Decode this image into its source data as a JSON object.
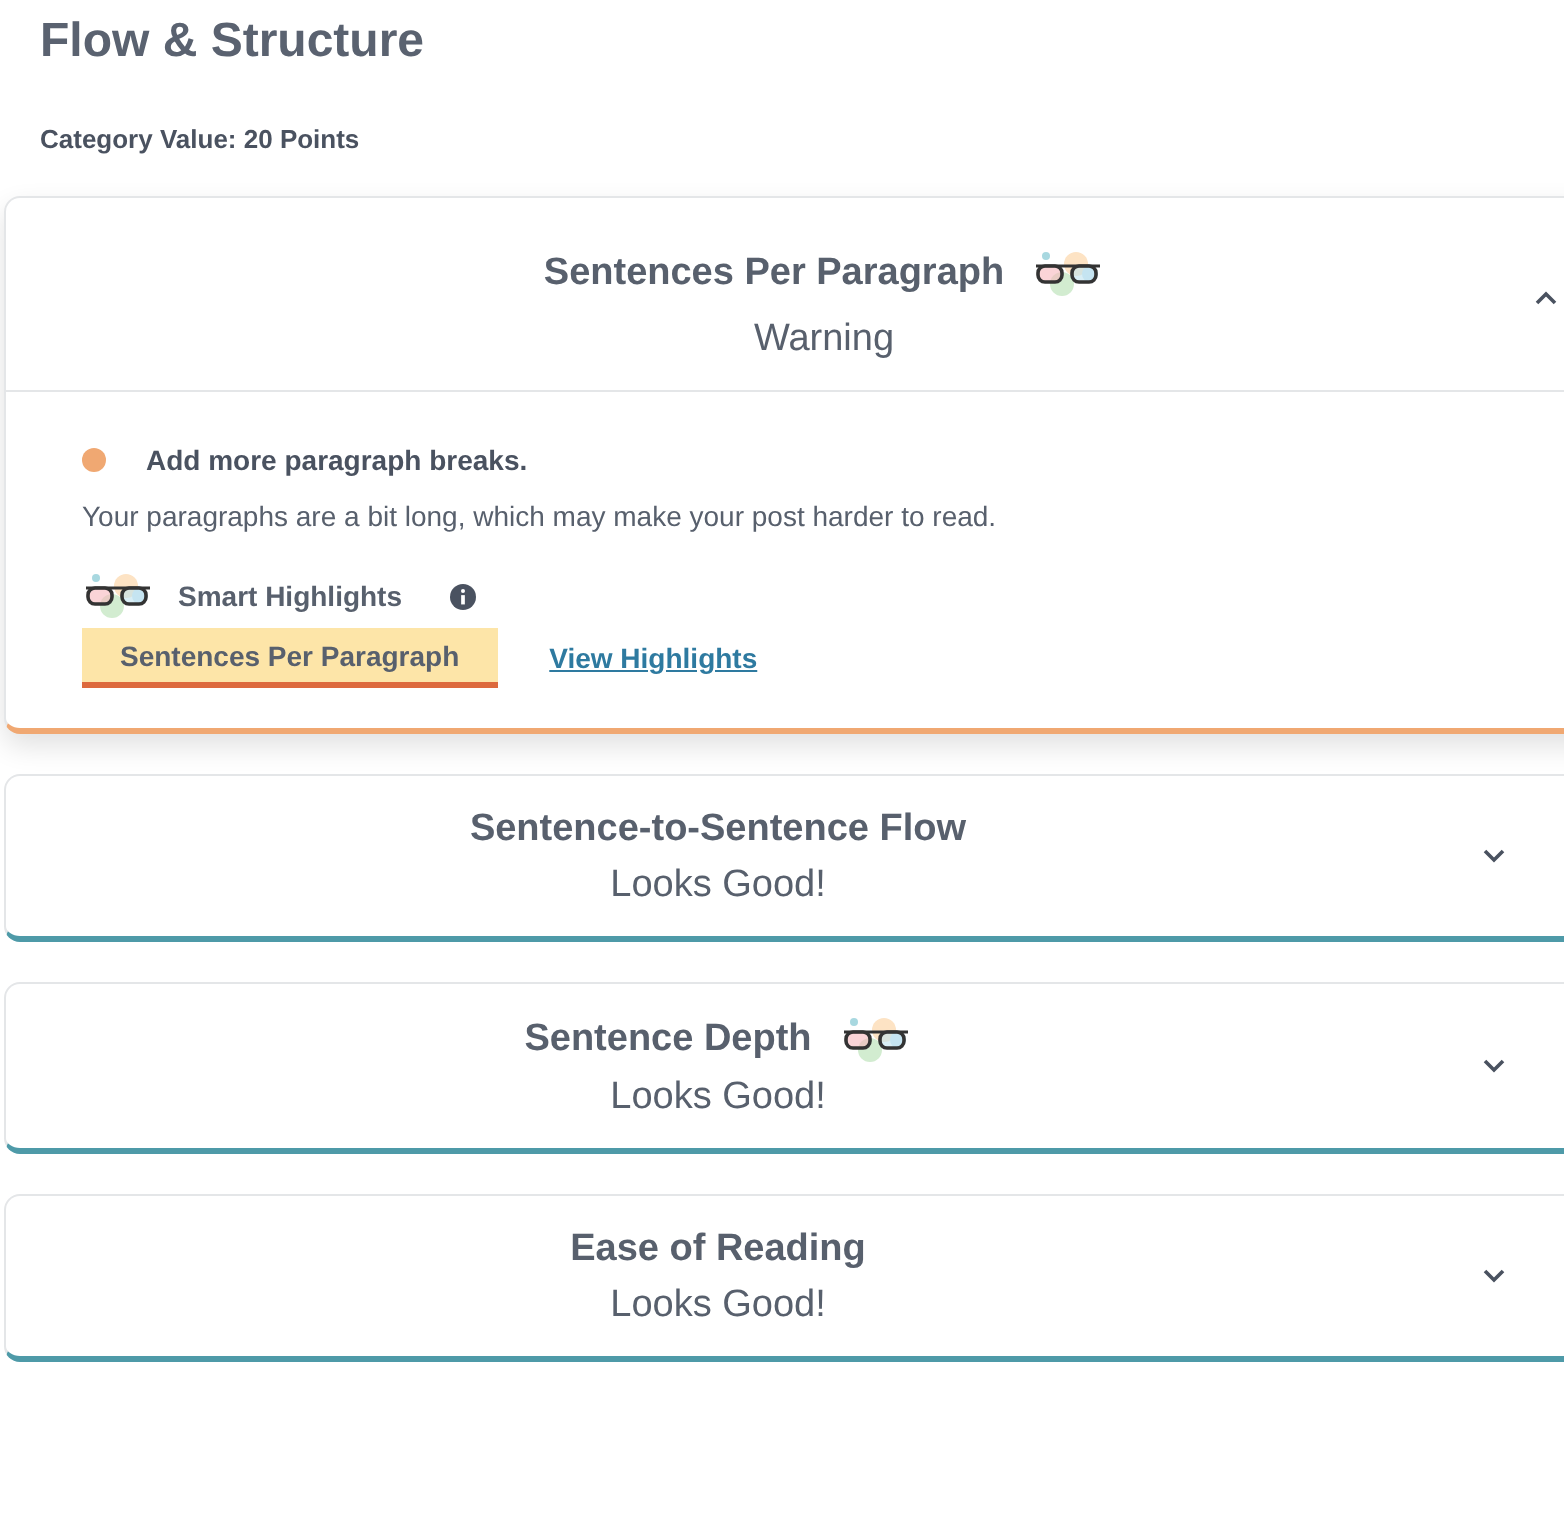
{
  "heading": "Flow & Structure",
  "category_value": "Category Value: 20 Points",
  "sections": [
    {
      "title": "Sentences Per Paragraph",
      "status": "Warning",
      "kind": "warning",
      "smart_highlights": true,
      "expanded": true,
      "issue": "Add more paragraph breaks.",
      "explanation": "Your paragraphs are a bit long, which may make your post harder to read.",
      "highlights_label": "Smart Highlights",
      "highlight_tag": "Sentences Per Paragraph",
      "highlights_link": "View Highlights"
    },
    {
      "title": "Sentence-to-Sentence Flow",
      "status": "Looks Good!",
      "kind": "good",
      "smart_highlights": false,
      "expanded": false
    },
    {
      "title": "Sentence Depth",
      "status": "Looks Good!",
      "kind": "good",
      "smart_highlights": true,
      "expanded": false
    },
    {
      "title": "Ease of Reading",
      "status": "Looks Good!",
      "kind": "good",
      "smart_highlights": false,
      "expanded": false
    }
  ]
}
